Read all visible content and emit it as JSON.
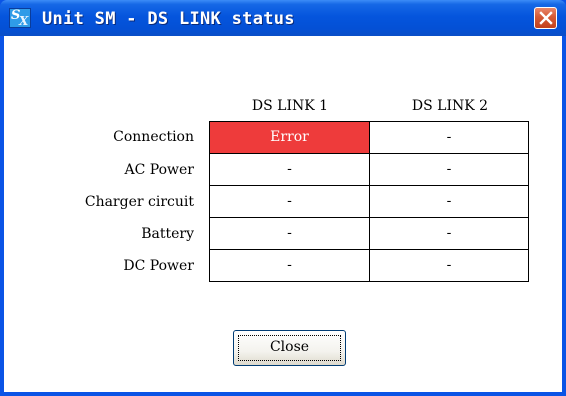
{
  "window": {
    "title": "Unit SM - DS LINK status",
    "icon": "sx-app-icon",
    "icon_letters": [
      "S",
      "X"
    ],
    "close_icon": "close-icon"
  },
  "table": {
    "columns": [
      "DS LINK 1",
      "DS LINK 2"
    ],
    "rows": [
      {
        "label": "Connection",
        "values": [
          "Error",
          "-"
        ]
      },
      {
        "label": "AC Power",
        "values": [
          "-",
          "-"
        ]
      },
      {
        "label": "Charger circuit",
        "values": [
          "-",
          "-"
        ]
      },
      {
        "label": "Battery",
        "values": [
          "-",
          "-"
        ]
      },
      {
        "label": "DC Power",
        "values": [
          "-",
          "-"
        ]
      }
    ],
    "error_color": "#ee3b3b"
  },
  "buttons": {
    "close_label": "Close"
  }
}
